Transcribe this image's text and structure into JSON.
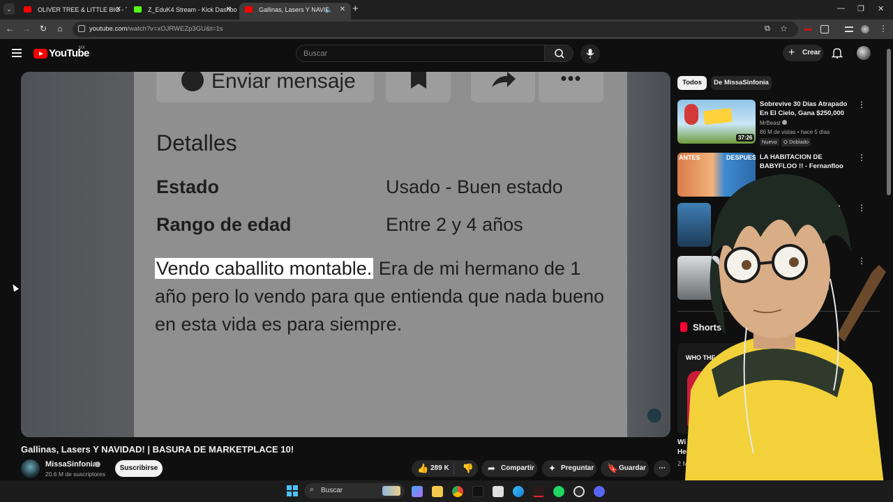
{
  "browser": {
    "tabs": [
      {
        "label": "OLIVER TREE & LITTLE BIG - TU",
        "close": "✕"
      },
      {
        "label": "Z_EduK4 Stream - Kick Dashbo",
        "close": "✕"
      },
      {
        "label": "Gallinas, Lasers Y NAVIDAD!",
        "close": "✕"
      }
    ],
    "new_tab": "+",
    "url_host": "youtube.com",
    "url_path": "/watch?v=xOJRWEZp3GU&t=1s",
    "window_controls": [
      "—",
      "❐",
      "✕"
    ]
  },
  "youtube": {
    "logo": "YouTube",
    "country": "MX",
    "search_placeholder": "Buscar",
    "create_label": "Crear"
  },
  "video_frame": {
    "message_button": "Enviar mensaje",
    "more_dots": "•••",
    "details_heading": "Detalles",
    "rows": [
      {
        "label": "Estado",
        "value": "Usado - Buen estado"
      },
      {
        "label": "Rango de edad",
        "value": "Entre 2 y 4 años"
      }
    ],
    "description_highlight": "Vendo caballito montable.",
    "description_rest": " Era de mi hermano de 1 año pero lo vendo para que entienda que nada bueno en esta vida es para siempre."
  },
  "video": {
    "title": "Gallinas, Lasers Y NAVIDAD! | BASURA DE MARKETPLACE 10!",
    "channel": "MissaSinfonia",
    "subscribers": "20.6 M de suscriptores",
    "subscribe_label": "Suscribirse",
    "likes": "289 K",
    "share_label": "Compartir",
    "ask_label": "Preguntar",
    "save_label": "Guardar"
  },
  "sidebar": {
    "chips": [
      "Todos",
      "De MissaSinfonia"
    ],
    "recommendations": [
      {
        "title": "Sobrevive 30 Días Atrapado En El Cielo, Gana $250,000",
        "channel": "MrBeast",
        "meta": "86 M de vistas • hace 5 días",
        "duration": "37:26",
        "badges": [
          "Nuevo",
          "Doblado"
        ]
      },
      {
        "title": "LA HABITACION DE BABYFLOO !! - Fernanfloo",
        "channel": "",
        "meta": "horas",
        "duration": ""
      },
      {
        "title": "",
        "channel": "",
        "meta": "",
        "duration": ""
      },
      {
        "title": "",
        "channel": "",
        "meta": "meses",
        "duration": ""
      }
    ],
    "shorts_label": "Shorts",
    "short_title_fragment_1": "Wi",
    "short_title_fragment_2": "Hec",
    "short_meta_fragment": "2 M",
    "short_thumb_text": "WHO THE"
  },
  "taskbar": {
    "search_label": "Buscar"
  },
  "colors": {
    "yt_red": "#ff0000",
    "background": "#0f0f0f"
  }
}
